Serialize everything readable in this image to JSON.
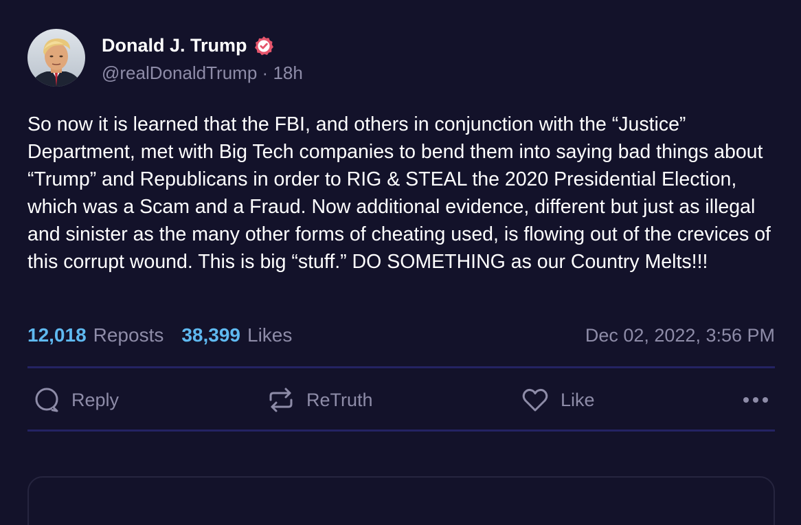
{
  "author": {
    "display_name": "Donald J. Trump",
    "handle": "@realDonaldTrump",
    "separator": "·",
    "age": "18h",
    "verified": true,
    "avatar_icon": "avatar-portrait",
    "verified_icon": "verified-badge-icon"
  },
  "post": {
    "text": "So now it is learned that the FBI, and others in conjunction with the “Justice” Department, met with Big Tech companies to bend them into saying bad things about “Trump” and Republicans in order to RIG & STEAL the 2020 Presidential Election, which was a Scam and a Fraud. Now additional evidence, different but just as illegal and sinister as the many other forms of cheating used, is flowing out of the crevices of this corrupt wound. This is big “stuff.” DO SOMETHING as our Country Melts!!!"
  },
  "stats": {
    "reposts_count": "12,018",
    "reposts_label": "Reposts",
    "likes_count": "38,399",
    "likes_label": "Likes",
    "timestamp": "Dec 02, 2022, 3:56 PM"
  },
  "actions": {
    "reply_label": "Reply",
    "retruth_label": "ReTruth",
    "like_label": "Like",
    "icons": [
      "reply-icon",
      "retruth-icon",
      "like-icon",
      "more-icon"
    ]
  },
  "colors": {
    "background": "#13122a",
    "accent": "#5fb9f0",
    "muted_text": "#8e8ca8",
    "divider": "#242363",
    "verified_badge": "#e5556c"
  }
}
